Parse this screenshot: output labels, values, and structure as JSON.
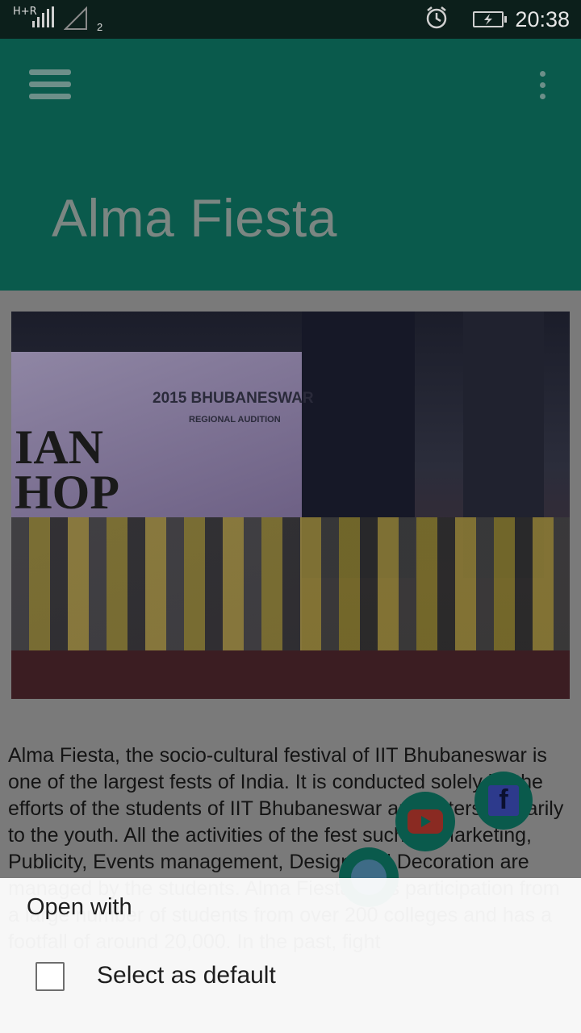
{
  "status_bar": {
    "network_type": "H+R",
    "sim_slot": "2",
    "time": "20:38",
    "icons": [
      "signal-icon",
      "no-signal-icon",
      "alarm-icon",
      "battery-charging-icon"
    ]
  },
  "app_bar": {
    "title": "Alma Fiesta",
    "color": "#0a5a4c",
    "icons": [
      "menu-icon",
      "more-vert-icon"
    ]
  },
  "hero": {
    "banner_title": "2015 BHUBANESWAR",
    "banner_subtitle": "REGIONAL AUDITION",
    "banner_letters": "IAN\nHOP"
  },
  "description": " Alma Fiesta, the socio-cultural festival of IIT Bhubaneswar is one of the largest fests of India. It is conducted solely by the efforts of the students of IIT Bhubaneswar and caters primarily to the youth. All the activities of the fest such as Marketing, Publicity, Events management, Design and Decoration are managed by the students. Alma Fiesta sees participation from a large number of students from over 200 colleges and has a footfall of around 20,000. In the past, fight",
  "social": {
    "facebook_glyph": "f",
    "icons": [
      "facebook-icon",
      "youtube-icon",
      "twitter-icon"
    ]
  },
  "sheet": {
    "title": "Open with",
    "default_label": "Select as default",
    "default_checked": false
  }
}
